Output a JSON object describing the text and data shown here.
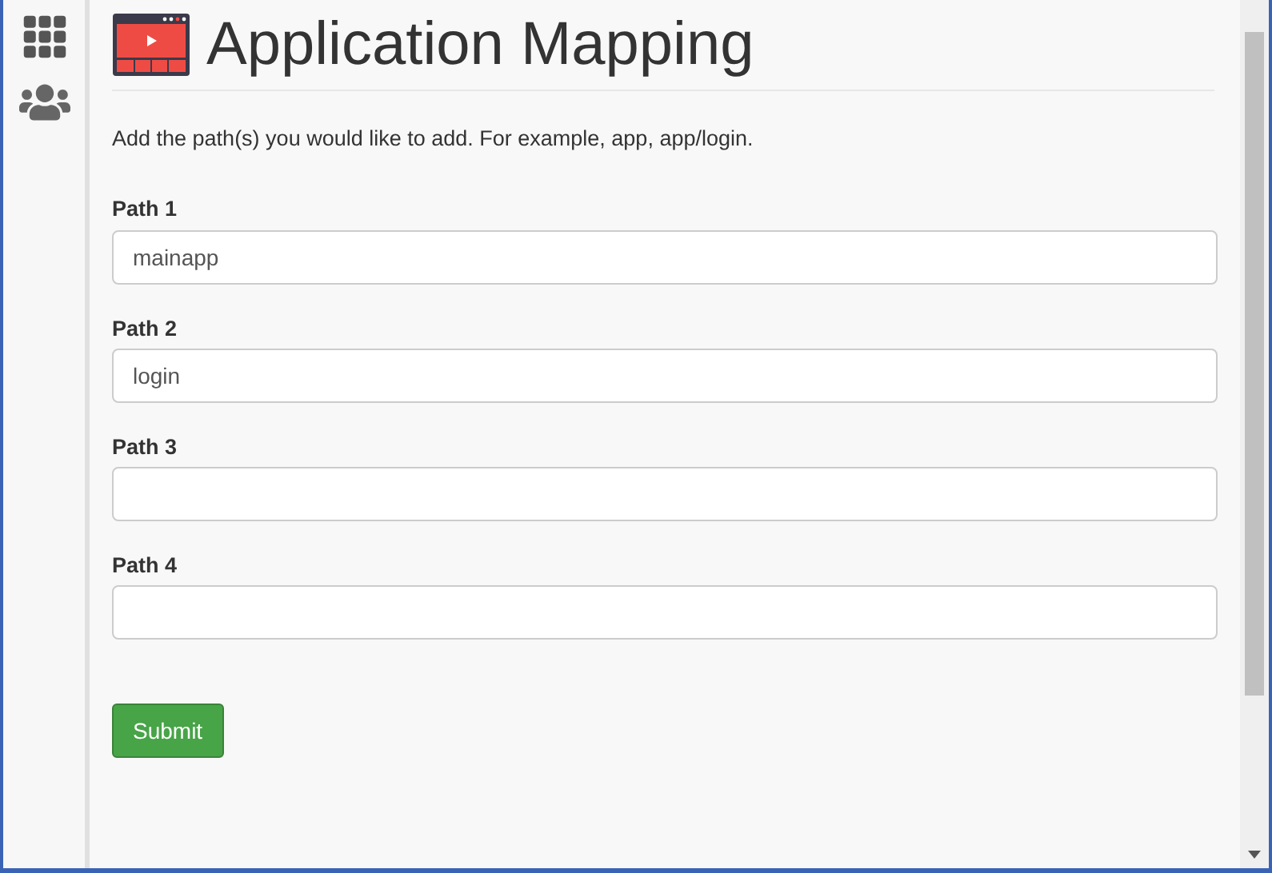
{
  "title": "Application Mapping",
  "instructions": "Add the path(s) you would like to add. For example, app, app/login.",
  "fields": [
    {
      "label": "Path 1",
      "value": "mainapp"
    },
    {
      "label": "Path 2",
      "value": "login"
    },
    {
      "label": "Path 3"
    },
    {
      "label": "Path 4"
    }
  ],
  "submit": "Submit"
}
